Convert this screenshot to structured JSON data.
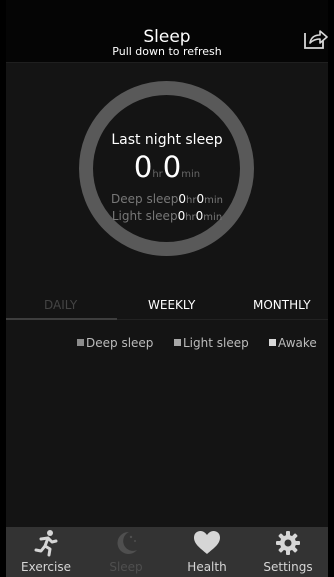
{
  "header": {
    "title": "Sleep",
    "subtitle": "Pull down to refresh",
    "share_icon": "share-icon"
  },
  "summary": {
    "title": "Last night sleep",
    "total_hours": "0",
    "total_hours_unit": "hr",
    "total_minutes": "0",
    "total_minutes_unit": "min",
    "deep": {
      "label": "Deep sleep",
      "hours": "0",
      "hours_unit": "hr",
      "minutes": "0",
      "minutes_unit": "min"
    },
    "light": {
      "label": "Light sleep",
      "hours": "0",
      "hours_unit": "hr",
      "minutes": "0",
      "minutes_unit": "min"
    },
    "ring_color": "#595959"
  },
  "tabs": {
    "selected": "DAILY",
    "items": [
      {
        "label": "DAILY"
      },
      {
        "label": "WEEKLY"
      },
      {
        "label": "MONTHLY"
      }
    ]
  },
  "legend": {
    "items": [
      {
        "label": "Deep sleep",
        "color": "#8c8c8c"
      },
      {
        "label": "Light sleep",
        "color": "#a8a8a8"
      },
      {
        "label": "Awake",
        "color": "#d8d8d8"
      }
    ]
  },
  "bottom_nav": {
    "selected": "Sleep",
    "items": [
      {
        "label": "Exercise",
        "icon": "running-person-icon"
      },
      {
        "label": "Sleep",
        "icon": "moon-icon"
      },
      {
        "label": "Health",
        "icon": "heart-icon"
      },
      {
        "label": "Settings",
        "icon": "gear-icon"
      }
    ]
  },
  "colors": {
    "header_bg": "#050505",
    "content_bg": "#141414",
    "nav_bg": "#333333",
    "inactive_tab": "#444444"
  }
}
